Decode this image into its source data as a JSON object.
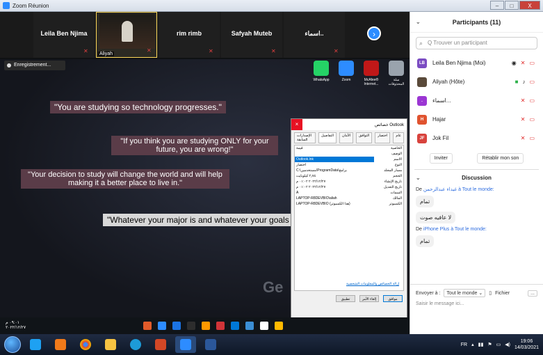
{
  "window": {
    "title": "Zoom Réunion",
    "minimize": "–",
    "maximize": "□",
    "close": "X"
  },
  "gallery": {
    "tiles": [
      {
        "name": "Leila Ben Njima"
      },
      {
        "name": "Aliyah",
        "video": true
      },
      {
        "name": "rim rimb"
      },
      {
        "name": "Safyah Muteb"
      },
      {
        "name": "اسماء.."
      }
    ],
    "next_icon": "›"
  },
  "share": {
    "recording": "Enregistrement...",
    "quotes": [
      "\"You are studying so technology progresses.\"",
      "\"If you think you are studying ONLY for your future, you are wrong!\"",
      "\"Your decision to study will change the world and will help making it a better place to live in.\"",
      "\"Whatever your major is and whatever your goals are.\""
    ],
    "desktop_icons": [
      {
        "label": "WhatsApp",
        "color": "#25d366"
      },
      {
        "label": "Zoom",
        "color": "#2d8cff"
      },
      {
        "label": "McAfee® Internet...",
        "color": "#c01818"
      },
      {
        "label": "سلة المحذوفات",
        "color": "#9aa3ad"
      }
    ],
    "watermark": "Ge"
  },
  "props_dialog": {
    "title": "خصائص Outlook",
    "close": "×",
    "tabs": [
      "عام",
      "اختصار",
      "التوافق",
      "الأمان",
      "التفاصيل",
      "الإصدارات السابقة"
    ],
    "active_tab": "التفاصيل",
    "headers": [
      "الخاصية",
      "قيمة"
    ],
    "rows": [
      {
        "k": "الوصف",
        "v": ""
      },
      {
        "k": "الاسم",
        "v": "Outlook.lnk",
        "selected": true
      },
      {
        "k": "النوع",
        "v": "اختصار"
      },
      {
        "k": "مسار المجلد",
        "v": "C:\\مستخدمين\\ProgramData\\برامج"
      },
      {
        "k": "الحجم",
        "v": "٢٫٧٤ كيلوبايت"
      },
      {
        "k": "تاريخ الإنشاء",
        "v": "٢٠٢٢/١٢/٢٧ ٠١:٠٢ م"
      },
      {
        "k": "تاريخ التعديل",
        "v": "٢٠٢٢/١٢/٢٧ ٠١:٠٢ م"
      },
      {
        "k": "السمات",
        "v": "A"
      },
      {
        "k": "المالك",
        "v": "LAPTOP-R8DEVBIO\\aliah"
      },
      {
        "k": "الكمبيوتر",
        "v": "LAPTOP-R8DEVBIO (هذا الكمبيوتر)"
      }
    ],
    "link": "إزالة الخصائص والمعلومات الشخصية",
    "buttons": [
      "موافق",
      "إلغاء الأمر",
      "تطبيق"
    ]
  },
  "participants": {
    "title": "Participants (11)",
    "search_placeholder": "Q Trouver un participant",
    "list": [
      {
        "initials": "LB",
        "name": "Leila Ben Njima (Moi)",
        "color": "#7b4cc2"
      },
      {
        "initials": "",
        "name": "Aliyah (Hôte)",
        "color": "#5a4a3a"
      },
      {
        "initials": ".",
        "name": "اسماء...",
        "color": "#9b36d3"
      },
      {
        "initials": "H",
        "name": "Hajar",
        "color": "#e0532f"
      },
      {
        "initials": "JF",
        "name": "Jok Fil",
        "color": "#d8433d"
      }
    ],
    "invite": "Inviter",
    "reset_sound": "Rétablir mon son"
  },
  "chat": {
    "title": "Discussion",
    "messages": [
      {
        "from": "De",
        "sender": "غيداء عبدالرحمن",
        "to": "à Tout le monde:",
        "texts": [
          "تمام",
          "لا عافيه صوت"
        ]
      },
      {
        "from": "De",
        "sender": "iPhone Plus",
        "to": "à Tout le monde:",
        "texts": [
          "تمام"
        ]
      }
    ],
    "send_to_label": "Envoyer à :",
    "send_to_value": "Tout le monde ⌄",
    "file_label": "Fichier",
    "more": "...",
    "input_placeholder": "Saisir le message ici..."
  },
  "inner_taskbar": {
    "time": "٠٩:٠١ م",
    "date": "٢٠٢٢/١٢/٢٧",
    "icons": [
      "#e05b2a",
      "#2d8cff",
      "#1b74e4",
      "#2d2d2d",
      "#ff9800",
      "#d13438",
      "#0078d7",
      "#3b8ed3",
      "#ffffff",
      "#ffb900"
    ]
  },
  "taskbar": {
    "apps": [
      "ie",
      "media",
      "chrome",
      "explorer",
      "edge",
      "powerpoint",
      "zoom",
      "word"
    ],
    "lang": "FR",
    "time": "19:06",
    "date": "14/03/2021"
  }
}
